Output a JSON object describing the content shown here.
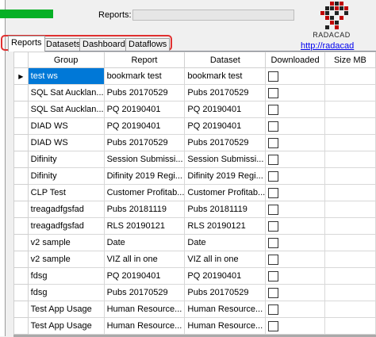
{
  "header": {
    "progress_pct": 100,
    "reports_label": "Reports:",
    "logo_text": "RADACAD",
    "logo_link": "http://radacad"
  },
  "tabs": [
    {
      "label": "Reports",
      "active": true
    },
    {
      "label": "Datasets",
      "active": false
    },
    {
      "label": "Dashboards",
      "active": false
    },
    {
      "label": "Dataflows",
      "active": false
    }
  ],
  "grid": {
    "columns": [
      "Group",
      "Report",
      "Dataset",
      "Downloaded",
      "Size MB"
    ],
    "current_row_marker": "▶",
    "rows": [
      {
        "group": "test ws",
        "report": "bookmark test",
        "dataset": "bookmark test",
        "downloaded": false,
        "size": ""
      },
      {
        "group": "SQL Sat Aucklan...",
        "report": "Pubs 20170529",
        "dataset": "Pubs 20170529",
        "downloaded": false,
        "size": ""
      },
      {
        "group": "SQL Sat Aucklan...",
        "report": "PQ 20190401",
        "dataset": "PQ 20190401",
        "downloaded": false,
        "size": ""
      },
      {
        "group": "DIAD WS",
        "report": "PQ 20190401",
        "dataset": "PQ 20190401",
        "downloaded": false,
        "size": ""
      },
      {
        "group": "DIAD WS",
        "report": "Pubs 20170529",
        "dataset": "Pubs 20170529",
        "downloaded": false,
        "size": ""
      },
      {
        "group": "Difinity",
        "report": "Session Submissi...",
        "dataset": "Session Submissi...",
        "downloaded": false,
        "size": ""
      },
      {
        "group": "Difinity",
        "report": "Difinity 2019 Regi...",
        "dataset": "Difinity 2019 Regi...",
        "downloaded": false,
        "size": ""
      },
      {
        "group": "CLP Test",
        "report": "Customer Profitab...",
        "dataset": "Customer Profitab...",
        "downloaded": false,
        "size": ""
      },
      {
        "group": "treagadfgsfad",
        "report": "Pubs 20181119",
        "dataset": "Pubs 20181119",
        "downloaded": false,
        "size": ""
      },
      {
        "group": "treagadfgsfad",
        "report": "RLS 20190121",
        "dataset": "RLS 20190121",
        "downloaded": false,
        "size": ""
      },
      {
        "group": "v2 sample",
        "report": "Date",
        "dataset": "Date",
        "downloaded": false,
        "size": ""
      },
      {
        "group": "v2 sample",
        "report": "VIZ all in one",
        "dataset": "VIZ all in one",
        "downloaded": false,
        "size": ""
      },
      {
        "group": "fdsg",
        "report": "PQ 20190401",
        "dataset": "PQ 20190401",
        "downloaded": false,
        "size": ""
      },
      {
        "group": "fdsg",
        "report": "Pubs 20170529",
        "dataset": "Pubs 20170529",
        "downloaded": false,
        "size": ""
      },
      {
        "group": "Test App Usage",
        "report": "Human Resource...",
        "dataset": "Human Resource...",
        "downloaded": false,
        "size": ""
      },
      {
        "group": "Test App Usage",
        "report": "Human Resource...",
        "dataset": "Human Resource...",
        "downloaded": false,
        "size": ""
      }
    ]
  },
  "colors": {
    "progress": "#06b025",
    "selection": "#0078d7",
    "tab_highlight": "#e03030"
  }
}
